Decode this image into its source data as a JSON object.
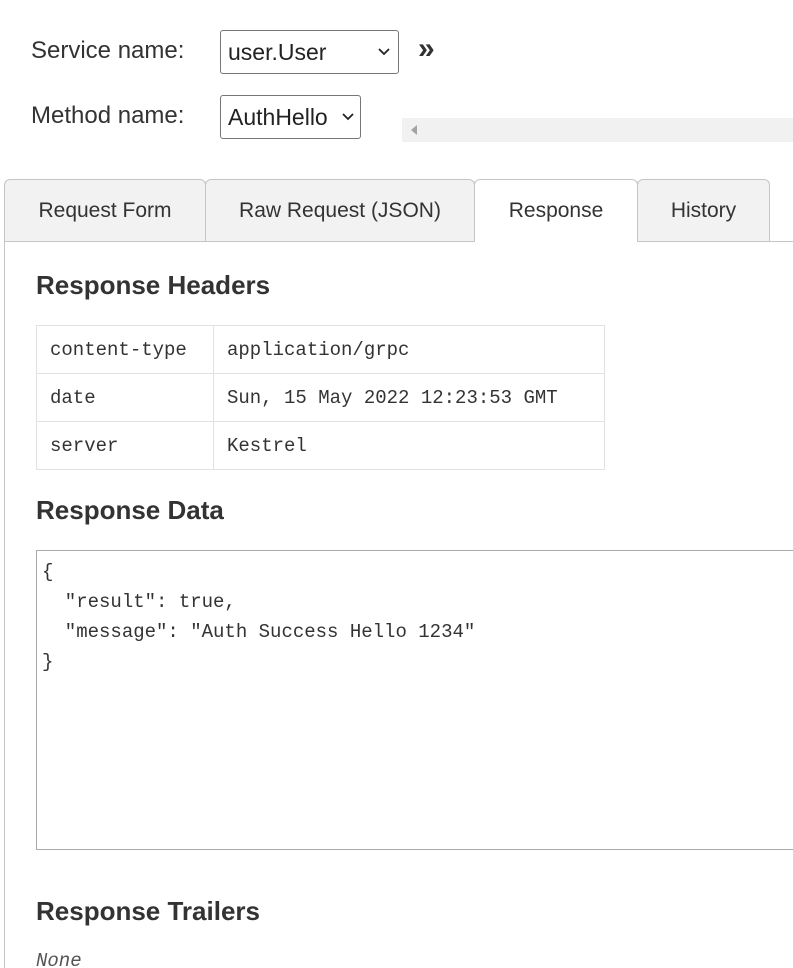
{
  "form": {
    "service_label": "Service name:",
    "service_value": "user.User",
    "method_label": "Method name:",
    "method_value": "AuthHello",
    "expand_glyph": "»"
  },
  "tabs": [
    {
      "label": "Request Form",
      "active": false
    },
    {
      "label": "Raw Request (JSON)",
      "active": false
    },
    {
      "label": "Response",
      "active": true
    },
    {
      "label": "History",
      "active": false
    }
  ],
  "response": {
    "headers_title": "Response Headers",
    "headers": [
      {
        "key": "content-type",
        "value": "application/grpc"
      },
      {
        "key": "date",
        "value": "Sun, 15 May 2022 12:23:53 GMT"
      },
      {
        "key": "server",
        "value": "Kestrel"
      }
    ],
    "data_title": "Response Data",
    "data_text": "{\n  \"result\": true,\n  \"message\": \"Auth Success Hello 1234\"\n}",
    "trailers_title": "Response Trailers",
    "trailers_value": "None"
  }
}
